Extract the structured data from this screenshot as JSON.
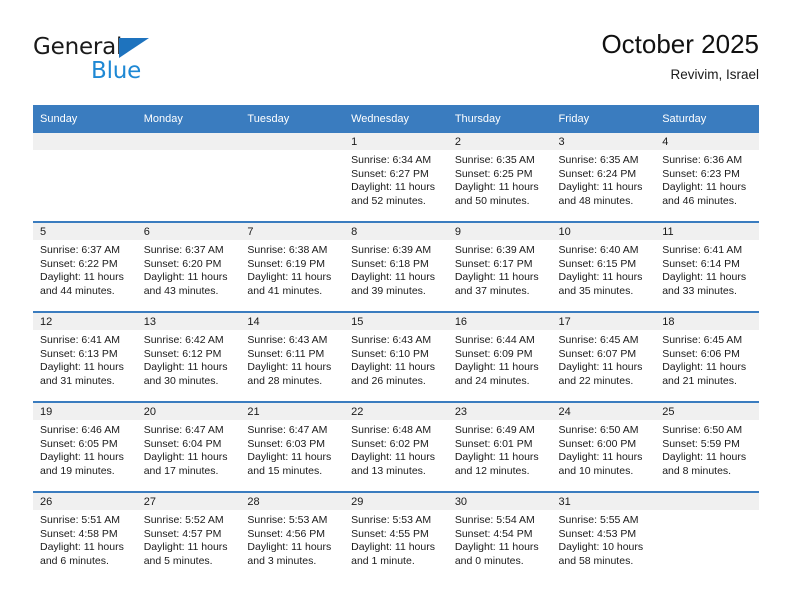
{
  "brand": {
    "name_part1": "General",
    "name_part2": "Blue",
    "triangle_icon": "triangle-icon",
    "accent_color": "#1e88d4"
  },
  "header": {
    "title": "October 2025",
    "subtitle": "Revivim, Israel"
  },
  "theme": {
    "header_bar_color": "#3a7cbf",
    "daynum_bg": "#f0f0f0",
    "text_color": "#1a1a1a"
  },
  "weekday_headers": [
    "Sunday",
    "Monday",
    "Tuesday",
    "Wednesday",
    "Thursday",
    "Friday",
    "Saturday"
  ],
  "weeks": [
    [
      {
        "day": "",
        "sunrise": "",
        "sunset": "",
        "daylight": "",
        "empty": true
      },
      {
        "day": "",
        "sunrise": "",
        "sunset": "",
        "daylight": "",
        "empty": true
      },
      {
        "day": "",
        "sunrise": "",
        "sunset": "",
        "daylight": "",
        "empty": true
      },
      {
        "day": "1",
        "sunrise": "Sunrise: 6:34 AM",
        "sunset": "Sunset: 6:27 PM",
        "daylight": "Daylight: 11 hours and 52 minutes."
      },
      {
        "day": "2",
        "sunrise": "Sunrise: 6:35 AM",
        "sunset": "Sunset: 6:25 PM",
        "daylight": "Daylight: 11 hours and 50 minutes."
      },
      {
        "day": "3",
        "sunrise": "Sunrise: 6:35 AM",
        "sunset": "Sunset: 6:24 PM",
        "daylight": "Daylight: 11 hours and 48 minutes."
      },
      {
        "day": "4",
        "sunrise": "Sunrise: 6:36 AM",
        "sunset": "Sunset: 6:23 PM",
        "daylight": "Daylight: 11 hours and 46 minutes."
      }
    ],
    [
      {
        "day": "5",
        "sunrise": "Sunrise: 6:37 AM",
        "sunset": "Sunset: 6:22 PM",
        "daylight": "Daylight: 11 hours and 44 minutes."
      },
      {
        "day": "6",
        "sunrise": "Sunrise: 6:37 AM",
        "sunset": "Sunset: 6:20 PM",
        "daylight": "Daylight: 11 hours and 43 minutes."
      },
      {
        "day": "7",
        "sunrise": "Sunrise: 6:38 AM",
        "sunset": "Sunset: 6:19 PM",
        "daylight": "Daylight: 11 hours and 41 minutes."
      },
      {
        "day": "8",
        "sunrise": "Sunrise: 6:39 AM",
        "sunset": "Sunset: 6:18 PM",
        "daylight": "Daylight: 11 hours and 39 minutes."
      },
      {
        "day": "9",
        "sunrise": "Sunrise: 6:39 AM",
        "sunset": "Sunset: 6:17 PM",
        "daylight": "Daylight: 11 hours and 37 minutes."
      },
      {
        "day": "10",
        "sunrise": "Sunrise: 6:40 AM",
        "sunset": "Sunset: 6:15 PM",
        "daylight": "Daylight: 11 hours and 35 minutes."
      },
      {
        "day": "11",
        "sunrise": "Sunrise: 6:41 AM",
        "sunset": "Sunset: 6:14 PM",
        "daylight": "Daylight: 11 hours and 33 minutes."
      }
    ],
    [
      {
        "day": "12",
        "sunrise": "Sunrise: 6:41 AM",
        "sunset": "Sunset: 6:13 PM",
        "daylight": "Daylight: 11 hours and 31 minutes."
      },
      {
        "day": "13",
        "sunrise": "Sunrise: 6:42 AM",
        "sunset": "Sunset: 6:12 PM",
        "daylight": "Daylight: 11 hours and 30 minutes."
      },
      {
        "day": "14",
        "sunrise": "Sunrise: 6:43 AM",
        "sunset": "Sunset: 6:11 PM",
        "daylight": "Daylight: 11 hours and 28 minutes."
      },
      {
        "day": "15",
        "sunrise": "Sunrise: 6:43 AM",
        "sunset": "Sunset: 6:10 PM",
        "daylight": "Daylight: 11 hours and 26 minutes."
      },
      {
        "day": "16",
        "sunrise": "Sunrise: 6:44 AM",
        "sunset": "Sunset: 6:09 PM",
        "daylight": "Daylight: 11 hours and 24 minutes."
      },
      {
        "day": "17",
        "sunrise": "Sunrise: 6:45 AM",
        "sunset": "Sunset: 6:07 PM",
        "daylight": "Daylight: 11 hours and 22 minutes."
      },
      {
        "day": "18",
        "sunrise": "Sunrise: 6:45 AM",
        "sunset": "Sunset: 6:06 PM",
        "daylight": "Daylight: 11 hours and 21 minutes."
      }
    ],
    [
      {
        "day": "19",
        "sunrise": "Sunrise: 6:46 AM",
        "sunset": "Sunset: 6:05 PM",
        "daylight": "Daylight: 11 hours and 19 minutes."
      },
      {
        "day": "20",
        "sunrise": "Sunrise: 6:47 AM",
        "sunset": "Sunset: 6:04 PM",
        "daylight": "Daylight: 11 hours and 17 minutes."
      },
      {
        "day": "21",
        "sunrise": "Sunrise: 6:47 AM",
        "sunset": "Sunset: 6:03 PM",
        "daylight": "Daylight: 11 hours and 15 minutes."
      },
      {
        "day": "22",
        "sunrise": "Sunrise: 6:48 AM",
        "sunset": "Sunset: 6:02 PM",
        "daylight": "Daylight: 11 hours and 13 minutes."
      },
      {
        "day": "23",
        "sunrise": "Sunrise: 6:49 AM",
        "sunset": "Sunset: 6:01 PM",
        "daylight": "Daylight: 11 hours and 12 minutes."
      },
      {
        "day": "24",
        "sunrise": "Sunrise: 6:50 AM",
        "sunset": "Sunset: 6:00 PM",
        "daylight": "Daylight: 11 hours and 10 minutes."
      },
      {
        "day": "25",
        "sunrise": "Sunrise: 6:50 AM",
        "sunset": "Sunset: 5:59 PM",
        "daylight": "Daylight: 11 hours and 8 minutes."
      }
    ],
    [
      {
        "day": "26",
        "sunrise": "Sunrise: 5:51 AM",
        "sunset": "Sunset: 4:58 PM",
        "daylight": "Daylight: 11 hours and 6 minutes."
      },
      {
        "day": "27",
        "sunrise": "Sunrise: 5:52 AM",
        "sunset": "Sunset: 4:57 PM",
        "daylight": "Daylight: 11 hours and 5 minutes."
      },
      {
        "day": "28",
        "sunrise": "Sunrise: 5:53 AM",
        "sunset": "Sunset: 4:56 PM",
        "daylight": "Daylight: 11 hours and 3 minutes."
      },
      {
        "day": "29",
        "sunrise": "Sunrise: 5:53 AM",
        "sunset": "Sunset: 4:55 PM",
        "daylight": "Daylight: 11 hours and 1 minute."
      },
      {
        "day": "30",
        "sunrise": "Sunrise: 5:54 AM",
        "sunset": "Sunset: 4:54 PM",
        "daylight": "Daylight: 11 hours and 0 minutes."
      },
      {
        "day": "31",
        "sunrise": "Sunrise: 5:55 AM",
        "sunset": "Sunset: 4:53 PM",
        "daylight": "Daylight: 10 hours and 58 minutes."
      },
      {
        "day": "",
        "sunrise": "",
        "sunset": "",
        "daylight": "",
        "empty": true
      }
    ]
  ]
}
